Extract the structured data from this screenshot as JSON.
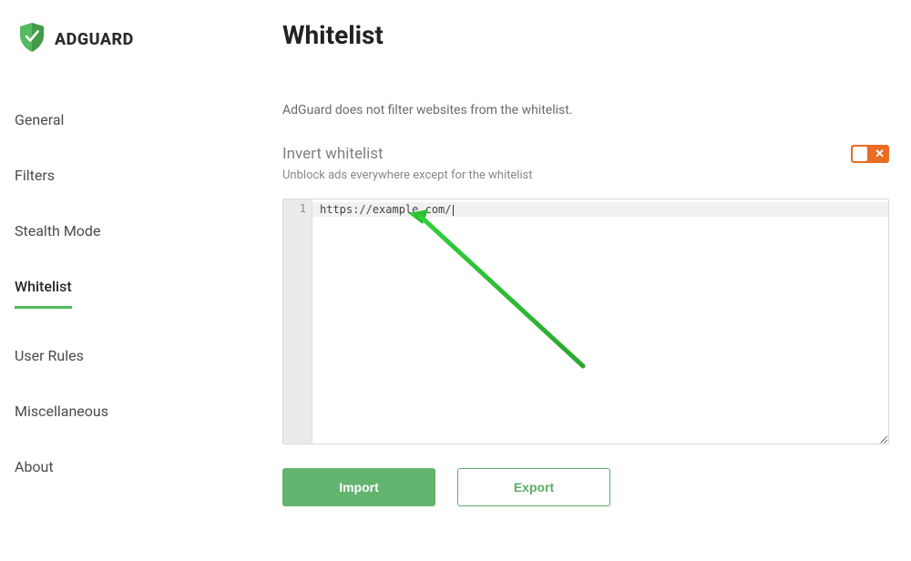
{
  "brand": "ADGUARD",
  "sidebar": {
    "items": [
      {
        "label": "General"
      },
      {
        "label": "Filters"
      },
      {
        "label": "Stealth Mode"
      },
      {
        "label": "Whitelist",
        "active": true
      },
      {
        "label": "User Rules"
      },
      {
        "label": "Miscellaneous"
      },
      {
        "label": "About"
      }
    ]
  },
  "page": {
    "title": "Whitelist",
    "description": "AdGuard does not filter websites from the whitelist."
  },
  "invert": {
    "title": "Invert whitelist",
    "subtitle": "Unblock ads everywhere except for the whitelist",
    "state": "off"
  },
  "editor": {
    "lines": [
      "https://example.com/"
    ],
    "gutter": [
      "1"
    ]
  },
  "buttons": {
    "import": "Import",
    "export": "Export"
  },
  "colors": {
    "accent": "#4fbb5b",
    "toggle": "#e96c23",
    "arrow": "#33cc33"
  }
}
